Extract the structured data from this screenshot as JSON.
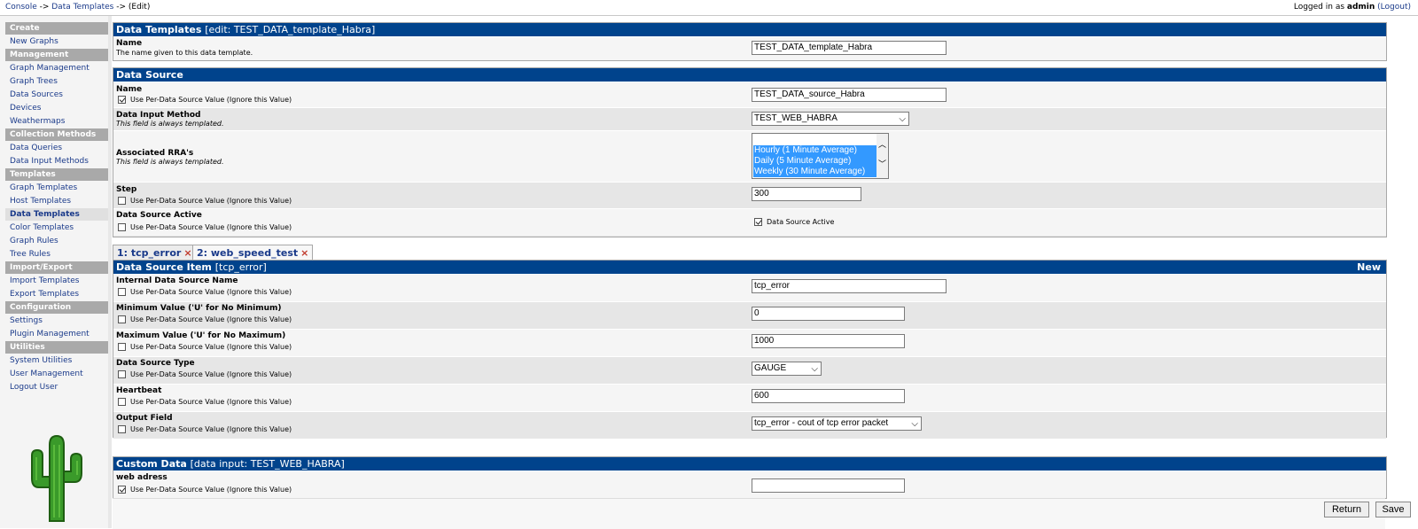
{
  "breadcrumb": {
    "console": "Console",
    "sep1": " -> ",
    "data_templates": "Data Templates",
    "sep2": " -> ",
    "edit": "(Edit)"
  },
  "login": {
    "prefix": "Logged in as ",
    "user": "admin",
    "logout": "(Logout)"
  },
  "sidebar": {
    "sections": [
      {
        "head": "Create",
        "items": [
          "New Graphs"
        ]
      },
      {
        "head": "Management",
        "items": [
          "Graph Management",
          "Graph Trees",
          "Data Sources",
          "Devices",
          "Weathermaps"
        ]
      },
      {
        "head": "Collection Methods",
        "items": [
          "Data Queries",
          "Data Input Methods"
        ]
      },
      {
        "head": "Templates",
        "items": [
          "Graph Templates",
          "Host Templates",
          "Data Templates",
          "Color Templates",
          "Graph Rules",
          "Tree Rules"
        ]
      },
      {
        "head": "Import/Export",
        "items": [
          "Import Templates",
          "Export Templates"
        ]
      },
      {
        "head": "Configuration",
        "items": [
          "Settings",
          "Plugin Management"
        ]
      },
      {
        "head": "Utilities",
        "items": [
          "System Utilities",
          "User Management",
          "Logout User"
        ]
      }
    ],
    "active": "Data Templates"
  },
  "template_panel": {
    "title": "Data Templates",
    "subtitle": "[edit: TEST_DATA_template_Habra]",
    "name_label": "Name",
    "name_hint": "The name given to this data template.",
    "name_value": "TEST_DATA_template_Habra"
  },
  "source_panel": {
    "title": "Data Source",
    "name_label": "Name",
    "use_per": "Use Per-Data Source Value (Ignore this Value)",
    "name_value": "TEST_DATA_source_Habra",
    "input_label": "Data Input Method",
    "always_templated": "This field is always templated.",
    "input_value": "TEST_WEB_HABRA",
    "rra_label": "Associated RRA's",
    "rra_options": [
      "Hourly (1 Minute Average)",
      "Daily (5 Minute Average)",
      "Weekly (30 Minute Average)"
    ],
    "step_label": "Step",
    "step_value": "300",
    "active_label": "Data Source Active",
    "active_value_label": "Data Source Active"
  },
  "tabs": [
    {
      "label": "1: tcp_error",
      "close": "×"
    },
    {
      "label": "2: web_speed_test",
      "close": "×"
    }
  ],
  "item_panel": {
    "title": "Data Source Item",
    "subtitle": "[tcp_error]",
    "new_label": "New",
    "use_per": "Use Per-Data Source Value (Ignore this Value)",
    "rows": [
      {
        "label": "Internal Data Source Name",
        "value": "tcp_error"
      },
      {
        "label": "Minimum Value ('U' for No Minimum)",
        "value": "0"
      },
      {
        "label": "Maximum Value ('U' for No Maximum)",
        "value": "1000"
      },
      {
        "label": "Data Source Type",
        "value": "GAUGE"
      },
      {
        "label": "Heartbeat",
        "value": "600"
      },
      {
        "label": "Output Field",
        "value": "tcp_error - cout of tcp error packet"
      }
    ]
  },
  "custom_panel": {
    "title": "Custom Data",
    "subtitle": "[data input: TEST_WEB_HABRA]",
    "field_label": "web adress",
    "use_per": "Use Per-Data Source Value (Ignore this Value)",
    "field_value": ""
  },
  "buttons": {
    "return": "Return",
    "save": "Save"
  },
  "colors": {
    "header": "#00438c",
    "nav_head": "#a9a9a9",
    "link": "#1a3a8a",
    "close": "#c0392b"
  }
}
